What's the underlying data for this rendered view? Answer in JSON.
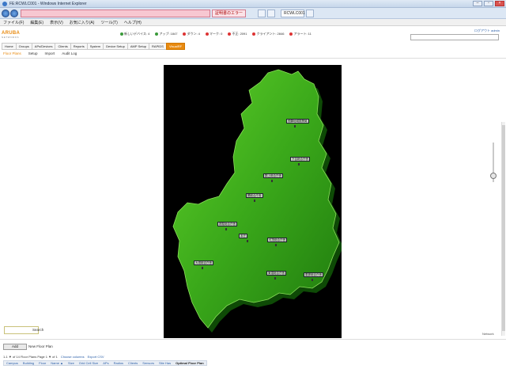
{
  "window": {
    "title": "FE:RCWLC001 - Windows Internet Explorer"
  },
  "browser": {
    "url": "",
    "certificate_error": "証明書のエラー",
    "tab_title": "RCWLC001"
  },
  "menu": [
    "ファイル(F)",
    "編集(E)",
    "表示(V)",
    "お気に入り(A)",
    "ツール(T)",
    "ヘルプ(H)"
  ],
  "app": {
    "logo_text": "ARUBA",
    "logo_sub": "NETWORKS",
    "user_text": "ログアウト admin",
    "stats": [
      {
        "label": "新しいデバイス: 4",
        "color": "#3a9a3a"
      },
      {
        "label": "アップ: 1847",
        "color": "#3a9a3a"
      },
      {
        "label": "ダウン: 4",
        "color": "#d33"
      },
      {
        "label": "マーク: 0",
        "color": "#d33"
      },
      {
        "label": "不正: 2091",
        "color": "#d33"
      },
      {
        "label": "クライアント: 2846",
        "color": "#d33"
      },
      {
        "label": "アラート: 11",
        "color": "#d33"
      }
    ]
  },
  "nav": {
    "tabs": [
      "Home",
      "Groups",
      "APs/Devices",
      "Clients",
      "Reports",
      "System",
      "Device Setup",
      "AMP Setup",
      "RAPIDS",
      "VisualRF"
    ],
    "active": "VisualRF",
    "subtabs": [
      "Floor Plans",
      "Setup",
      "Import",
      "Audit Log"
    ],
    "active_sub": "Floor Plans"
  },
  "map": {
    "labels": [
      {
        "text": "飛騨地域振興局"
      },
      {
        "text": "下呂総合庁舎"
      },
      {
        "text": "郡上総合庁舎"
      },
      {
        "text": "関総合庁舎"
      },
      {
        "text": "揖斐総合庁舎"
      },
      {
        "text": "本庁"
      },
      {
        "text": "可茂総合庁舎"
      },
      {
        "text": "大垣総合庁舎"
      },
      {
        "text": "東濃総合庁舎"
      },
      {
        "text": "恵那総合庁舎"
      }
    ]
  },
  "side": {
    "network_label": "Network"
  },
  "search": {
    "button": "Search"
  },
  "bottom": {
    "add_button": "Add",
    "add_label": "New Floor Plan",
    "pager_text": "1-1 ▼ of 14 Floor Plans  Page 1 ▼ of 1",
    "choose_columns": "Choose columns",
    "export_csv": "Export CSV",
    "columns": [
      "Campus",
      "Building",
      "Floor",
      "Name ▲",
      "Size",
      "Grid Cell Size",
      "APs",
      "Radios",
      "Clients",
      "Sensors",
      "Site Has",
      "Optimal Floor Plan"
    ]
  }
}
